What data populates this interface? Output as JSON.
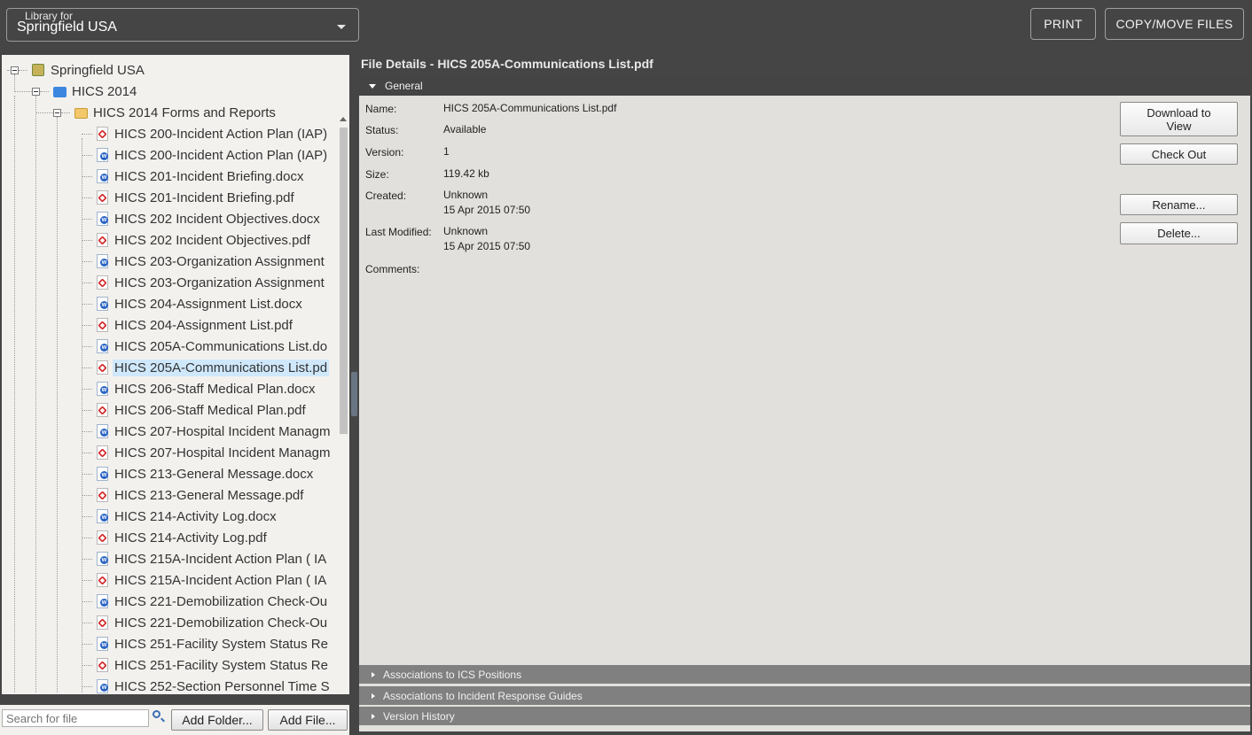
{
  "library": {
    "label": "Library for",
    "value": "Springfield USA"
  },
  "toolbar": {
    "print": "PRINT",
    "copy_move": "COPY/MOVE FILES"
  },
  "tree": {
    "root": "Springfield USA",
    "folder": "HICS 2014",
    "subfolder": "HICS 2014 Forms and Reports",
    "files": [
      {
        "name": "HICS 200-Incident Action Plan (IAP)",
        "type": "pdf"
      },
      {
        "name": "HICS 200-Incident Action Plan (IAP)",
        "type": "docx"
      },
      {
        "name": "HICS 201-Incident Briefing.docx",
        "type": "docx"
      },
      {
        "name": "HICS 201-Incident Briefing.pdf",
        "type": "pdf"
      },
      {
        "name": "HICS 202 Incident Objectives.docx",
        "type": "docx"
      },
      {
        "name": "HICS 202 Incident Objectives.pdf",
        "type": "pdf"
      },
      {
        "name": "HICS 203-Organization Assignment",
        "type": "docx"
      },
      {
        "name": "HICS 203-Organization Assignment",
        "type": "pdf"
      },
      {
        "name": "HICS 204-Assignment List.docx",
        "type": "docx"
      },
      {
        "name": "HICS 204-Assignment List.pdf",
        "type": "pdf"
      },
      {
        "name": "HICS 205A-Communications List.do",
        "type": "docx"
      },
      {
        "name": "HICS 205A-Communications List.pd",
        "type": "pdf"
      },
      {
        "name": "HICS 206-Staff Medical Plan.docx",
        "type": "docx"
      },
      {
        "name": "HICS 206-Staff Medical Plan.pdf",
        "type": "pdf"
      },
      {
        "name": "HICS 207-Hospital Incident Managm",
        "type": "docx"
      },
      {
        "name": "HICS 207-Hospital Incident Managm",
        "type": "pdf"
      },
      {
        "name": "HICS 213-General Message.docx",
        "type": "docx"
      },
      {
        "name": "HICS 213-General Message.pdf",
        "type": "pdf"
      },
      {
        "name": "HICS 214-Activity Log.docx",
        "type": "docx"
      },
      {
        "name": "HICS 214-Activity Log.pdf",
        "type": "pdf"
      },
      {
        "name": "HICS 215A-Incident Action Plan ( IA",
        "type": "docx"
      },
      {
        "name": "HICS 215A-Incident Action Plan ( IA",
        "type": "pdf"
      },
      {
        "name": "HICS 221-Demobilization Check-Ou",
        "type": "docx"
      },
      {
        "name": "HICS 221-Demobilization Check-Ou",
        "type": "pdf"
      },
      {
        "name": "HICS 251-Facility System Status Re",
        "type": "docx"
      },
      {
        "name": "HICS 251-Facility System Status Re",
        "type": "pdf"
      },
      {
        "name": "HICS 252-Section Personnel Time S",
        "type": "docx"
      }
    ],
    "selected_index": 11
  },
  "bottom": {
    "search_placeholder": "Search for file",
    "add_folder": "Add Folder...",
    "add_file": "Add File..."
  },
  "details": {
    "title": "File Details - HICS 205A-Communications List.pdf",
    "general_header": "General",
    "labels": {
      "name": "Name:",
      "status": "Status:",
      "version": "Version:",
      "size": "Size:",
      "created": "Created:",
      "last_modified": "Last Modified:",
      "comments": "Comments:"
    },
    "values": {
      "name": "HICS 205A-Communications List.pdf",
      "status": "Available",
      "version": "1",
      "size": "119.42 kb",
      "created_by": "Unknown",
      "created_date": "15 Apr 2015 07:50",
      "modified_by": "Unknown",
      "modified_date": "15 Apr 2015 07:50"
    },
    "buttons": {
      "download": "Download to View",
      "check_out": "Check Out",
      "rename": "Rename...",
      "delete": "Delete..."
    },
    "sections": [
      "Associations to ICS Positions",
      "Associations to Incident Response Guides",
      "Version History"
    ]
  }
}
